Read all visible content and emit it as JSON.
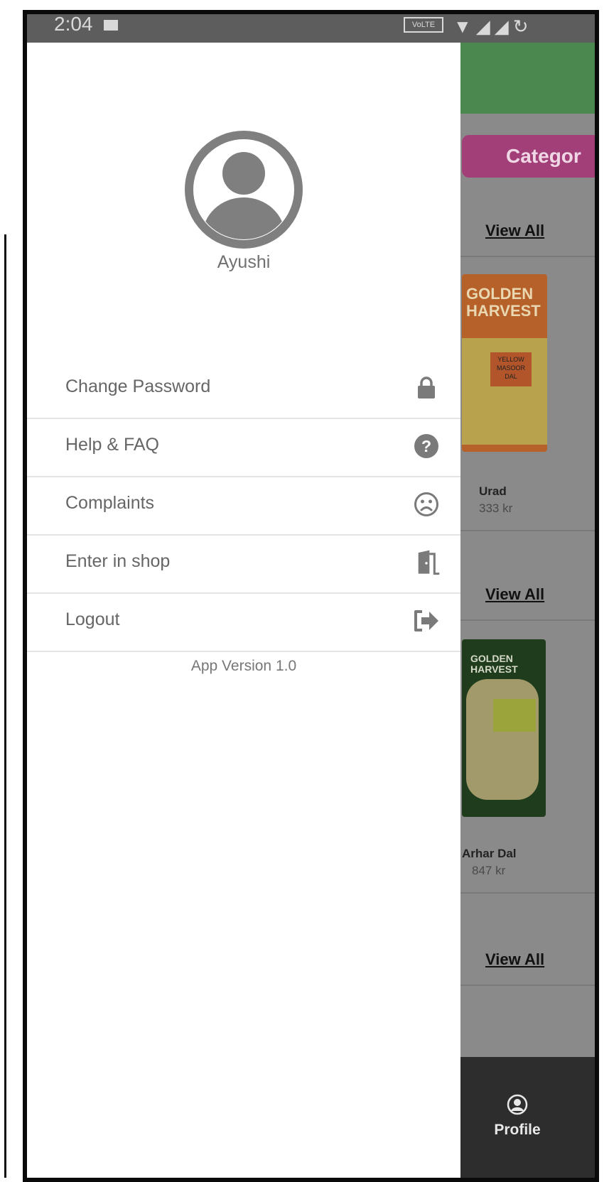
{
  "status_bar": {
    "time": "2:04",
    "network": "VoLTE"
  },
  "drawer": {
    "user_name": "Ayushi",
    "menu": [
      {
        "label": "Change Password",
        "icon": "lock-icon"
      },
      {
        "label": "Help & FAQ",
        "icon": "help-icon"
      },
      {
        "label": "Complaints",
        "icon": "sad-face-icon"
      },
      {
        "label": "Enter in shop",
        "icon": "door-icon"
      },
      {
        "label": "Logout",
        "icon": "logout-icon"
      }
    ],
    "app_version": "App Version 1.0"
  },
  "background": {
    "category_label": "Categor",
    "view_all_label": "View All",
    "products": [
      {
        "name": "Urad",
        "price": "333 kr"
      },
      {
        "name": "Arhar Dal",
        "price": "847 kr"
      }
    ],
    "bottom_nav": {
      "profile_label": "Profile"
    }
  },
  "colors": {
    "header_green": "#4a8850",
    "category_magenta": "#a33f78",
    "drawer_bg": "#ffffff",
    "icon_gray": "#7a7a7a"
  }
}
